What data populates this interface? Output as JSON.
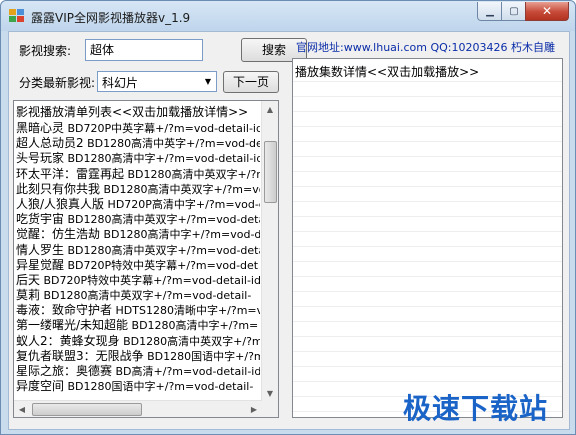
{
  "window": {
    "title": "露露VIP全网影视播放器v_1.9"
  },
  "search": {
    "label": "影视搜索:",
    "value": "超体",
    "button": "搜索"
  },
  "category": {
    "label": "分类最新影视:",
    "selected": "科幻片",
    "next_button": "下一页"
  },
  "info": {
    "site": "官网地址:www.lhuai.com QQ:10203426 朽木自雕"
  },
  "movie_list": {
    "header": "影视播放清单列表<<双击加载播放详情>>",
    "items": [
      {
        "name": "黑暗心灵",
        "info": " BD720P中英字幕+/?m=vod-detail-id"
      },
      {
        "name": "超人总动员2",
        "info": " BD1280高清中英字+/?m=vod-detail-"
      },
      {
        "name": "头号玩家",
        "info": " BD1280高清中字+/?m=vod-detail-id"
      },
      {
        "name": "环太平洋：雷霆再起",
        "info": " BD1280高清中英双字+/?m="
      },
      {
        "name": "此刻只有你共我",
        "info": " BD1280高清中英双字+/?m=vod"
      },
      {
        "name": "人狼/人狼真人版",
        "info": " HD720P高清中字+/?m=vod-det"
      },
      {
        "name": "吃货宇宙",
        "info": " BD1280高清中英双字+/?m=vod-deta"
      },
      {
        "name": "觉醒：仿生浩劫",
        "info": " BD1280高清中字+/?m=vod-det"
      },
      {
        "name": "情人罗生",
        "info": " BD1280高清中英双字+/?m=vod-deta"
      },
      {
        "name": "异星觉醒",
        "info": " BD720P特效中英字幕+/?m=vod-det"
      },
      {
        "name": "后天",
        "info": " BD720P特效中英字幕+/?m=vod-detail-id"
      },
      {
        "name": "莫莉",
        "info": " BD1280高清中英双字+/?m=vod-detail-"
      },
      {
        "name": "毒液：致命守护者",
        "info": " HDTS1280清晰中字+/?m=vod"
      },
      {
        "name": "第一缕曙光/未知超能",
        "info": " BD1280高清中字+/?m="
      },
      {
        "name": "蚁人2：黄蜂女现身",
        "info": " BD1280高清中英双字+/?m="
      },
      {
        "name": "复仇者联盟3：无限战争",
        "info": " BD1280国语中字+/?m"
      },
      {
        "name": "星际之旅：奥德赛",
        "info": " BD高清+/?m=vod-detail-id"
      },
      {
        "name": "异度空间",
        "info": " BD1280国语中字+/?m=vod-detail-"
      }
    ]
  },
  "episodes": {
    "header": "播放集数详情<<双击加载播放>>"
  },
  "watermark": {
    "text": "极速下载站"
  }
}
